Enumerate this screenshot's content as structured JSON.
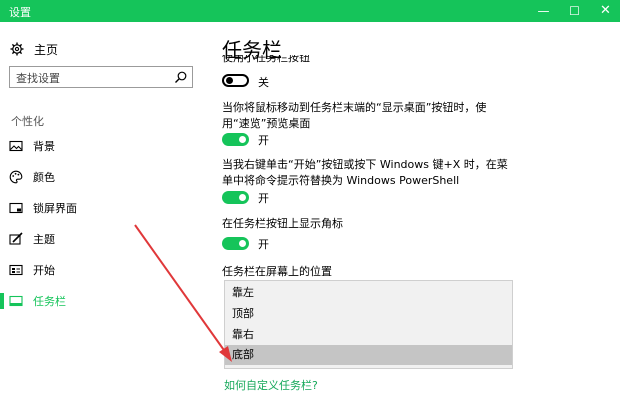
{
  "window": {
    "title": "设置",
    "minimize_glyph": "—",
    "maximize_glyph": "☐",
    "close_glyph": "✕",
    "accent_color": "#15c45a"
  },
  "sidebar": {
    "home_label": "主页",
    "home_icon": "gear-icon",
    "search_placeholder": "查找设置",
    "search_icon": "search-icon",
    "section_label": "个性化",
    "items": [
      {
        "label": "背景",
        "icon": "picture-icon",
        "active": false
      },
      {
        "label": "颜色",
        "icon": "palette-icon",
        "active": false
      },
      {
        "label": "锁屏界面",
        "icon": "lockscreen-icon",
        "active": false
      },
      {
        "label": "主题",
        "icon": "brush-icon",
        "active": false
      },
      {
        "label": "开始",
        "icon": "start-icon",
        "active": false
      },
      {
        "label": "任务栏",
        "icon": "taskbar-icon",
        "active": true
      }
    ]
  },
  "main": {
    "title": "任务栏",
    "partial_text": "使用小任务栏按钮",
    "settings": [
      {
        "description": "",
        "toggle_state": "off",
        "toggle_label": "关"
      },
      {
        "description": "当你将鼠标移动到任务栏末端的“显示桌面”按钮时，使用“速览”预览桌面",
        "toggle_state": "on",
        "toggle_label": "开"
      },
      {
        "description": "当我右键单击“开始”按钮或按下 Windows 键+X 时，在菜单中将命令提示符替换为 Windows PowerShell",
        "toggle_state": "on",
        "toggle_label": "开"
      },
      {
        "description": "在任务栏按钮上显示角标",
        "toggle_state": "on",
        "toggle_label": "开"
      }
    ],
    "dropdown": {
      "label": "任务栏在屏幕上的位置",
      "options": [
        "靠左",
        "顶部",
        "靠右",
        "底部"
      ],
      "selected": "底部"
    },
    "help_link": "如何自定义任务栏?"
  },
  "annotation": {
    "arrow_color": "#e0383a"
  }
}
